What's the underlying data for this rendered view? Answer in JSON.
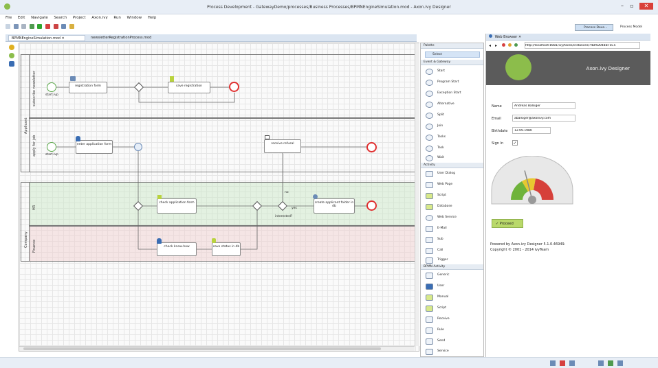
{
  "window": {
    "title": "Process Development - GatewayDemo/processes/Business Processes/BPMNEngineSimulation.mod - Axon.ivy Designer"
  },
  "menu": [
    "File",
    "Edit",
    "Navigate",
    "Search",
    "Project",
    "Axon.ivy",
    "Run",
    "Window",
    "Help"
  ],
  "perspectives": {
    "process_dev": "Process Deve...",
    "process_model": "Process Model"
  },
  "editor_tabs": [
    "BPMNEngineSimulation.mod",
    "newsletterRegistrationProcess.mod"
  ],
  "pools": {
    "applicant": "Applicant",
    "company": "Company"
  },
  "lanes": {
    "newsletter": "subscribe newsletter",
    "job": "apply for job",
    "hr": "HR",
    "finance": "Finance"
  },
  "process": {
    "start1": "start.ivp",
    "registration_form": "registration form",
    "save_registration": "save registration",
    "start2": "start.ivp",
    "enter_application": "enter application form",
    "receive_refusal": "receive refusal",
    "check_application": "check application form",
    "no_label": "no",
    "yes_label": "yes",
    "interested": "interested?",
    "create_folder": "create applicant folder in db",
    "check_know_how": "check know-how",
    "save_status": "save status in db"
  },
  "palette": {
    "title": "Palette",
    "select": "Select",
    "event_section": "Event & Gateway",
    "events": [
      "Start",
      "Program Start",
      "Exception Start",
      "Alternative",
      "Split",
      "Join",
      "Tasks",
      "Task",
      "Wait"
    ],
    "activity_section": "Activity",
    "activities": [
      "User Dialog",
      "Web Page",
      "Script",
      "Database",
      "Web Service",
      "E-Mail",
      "Sub",
      "Call",
      "Trigger"
    ],
    "bpmn_section": "BPMN Activity",
    "bpmn": [
      "Generic",
      "User",
      "Manual",
      "Script",
      "Receive",
      "Rule",
      "Send",
      "Service"
    ]
  },
  "browser": {
    "tab": "Web Browser",
    "url": "http://localhost:8081/ivy/faces/instances/?4BAD04BB7SC5",
    "brand": "Axon.ivy Designer",
    "name_label": "Name",
    "name_value": "Andreas Balsiger",
    "email_label": "Email",
    "email_value": "abalsiger@axonivy.com",
    "birthdate_label": "Birthdate",
    "birthdate_value": "12.09.1980",
    "signin_label": "Sign In",
    "proceed": "Proceed",
    "powered": "Powered by Axon.ivy Designer 5.1.0.46949.",
    "copyright": "Copyright © 2001 - 2014 ivyTeam",
    "gauge_level": 0.42
  },
  "colors": {
    "accent": "#8cbd4b",
    "hr_lane": "#e9f3e6",
    "finance_lane": "#f6e8e8",
    "end_event": "#e03030"
  }
}
